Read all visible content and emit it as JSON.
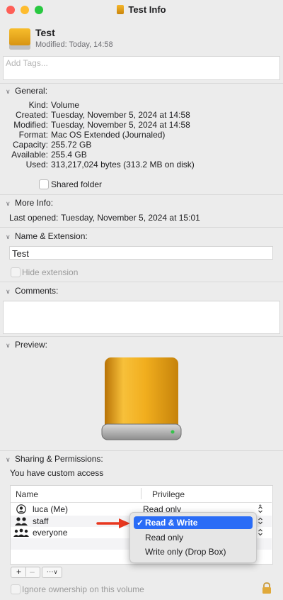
{
  "window": {
    "title": "Test Info"
  },
  "colors": {
    "close": "#fe5f57",
    "minimize": "#febc2e",
    "zoom": "#28c840",
    "accent": "#2a6cf6",
    "arrow": "#e8371f",
    "drive": "#f2b12a"
  },
  "header": {
    "name": "Test",
    "modified": "Modified: Today, 14:58"
  },
  "tags": {
    "placeholder": "Add Tags..."
  },
  "general": {
    "heading": "General:",
    "rows": [
      {
        "label": "Kind:",
        "value": "Volume"
      },
      {
        "label": "Created:",
        "value": "Tuesday, November 5, 2024 at 14:58"
      },
      {
        "label": "Modified:",
        "value": "Tuesday, November 5, 2024 at 14:58"
      },
      {
        "label": "Format:",
        "value": "Mac OS Extended (Journaled)"
      },
      {
        "label": "Capacity:",
        "value": "255.72 GB"
      },
      {
        "label": "Available:",
        "value": "255.4 GB"
      },
      {
        "label": "Used:",
        "value": "313,217,024 bytes (313.2 MB on disk)"
      }
    ],
    "shared_folder": "Shared folder"
  },
  "more_info": {
    "heading": "More Info:",
    "last_opened": "Last opened:",
    "last_opened_value": "Tuesday, November 5, 2024 at 15:01"
  },
  "name_ext": {
    "heading": "Name & Extension:",
    "name_value": "Test",
    "hide_extension": "Hide extension"
  },
  "comments": {
    "heading": "Comments:"
  },
  "preview": {
    "heading": "Preview:"
  },
  "sharing": {
    "heading": "Sharing & Permissions:",
    "access": "You have custom access",
    "col_name": "Name",
    "col_privilege": "Privilege",
    "users": [
      {
        "name": "luca (Me)",
        "privilege": "Read only",
        "icon": "person-icon"
      },
      {
        "name": "staff",
        "privilege": "",
        "icon": "group-icon"
      },
      {
        "name": "everyone",
        "privilege": "",
        "icon": "everyone-icon"
      }
    ],
    "menu": {
      "options": [
        "Read & Write",
        "Read only",
        "Write only (Drop Box)"
      ],
      "selected": "Read & Write"
    },
    "ignore_ownership": "Ignore ownership on this volume"
  }
}
